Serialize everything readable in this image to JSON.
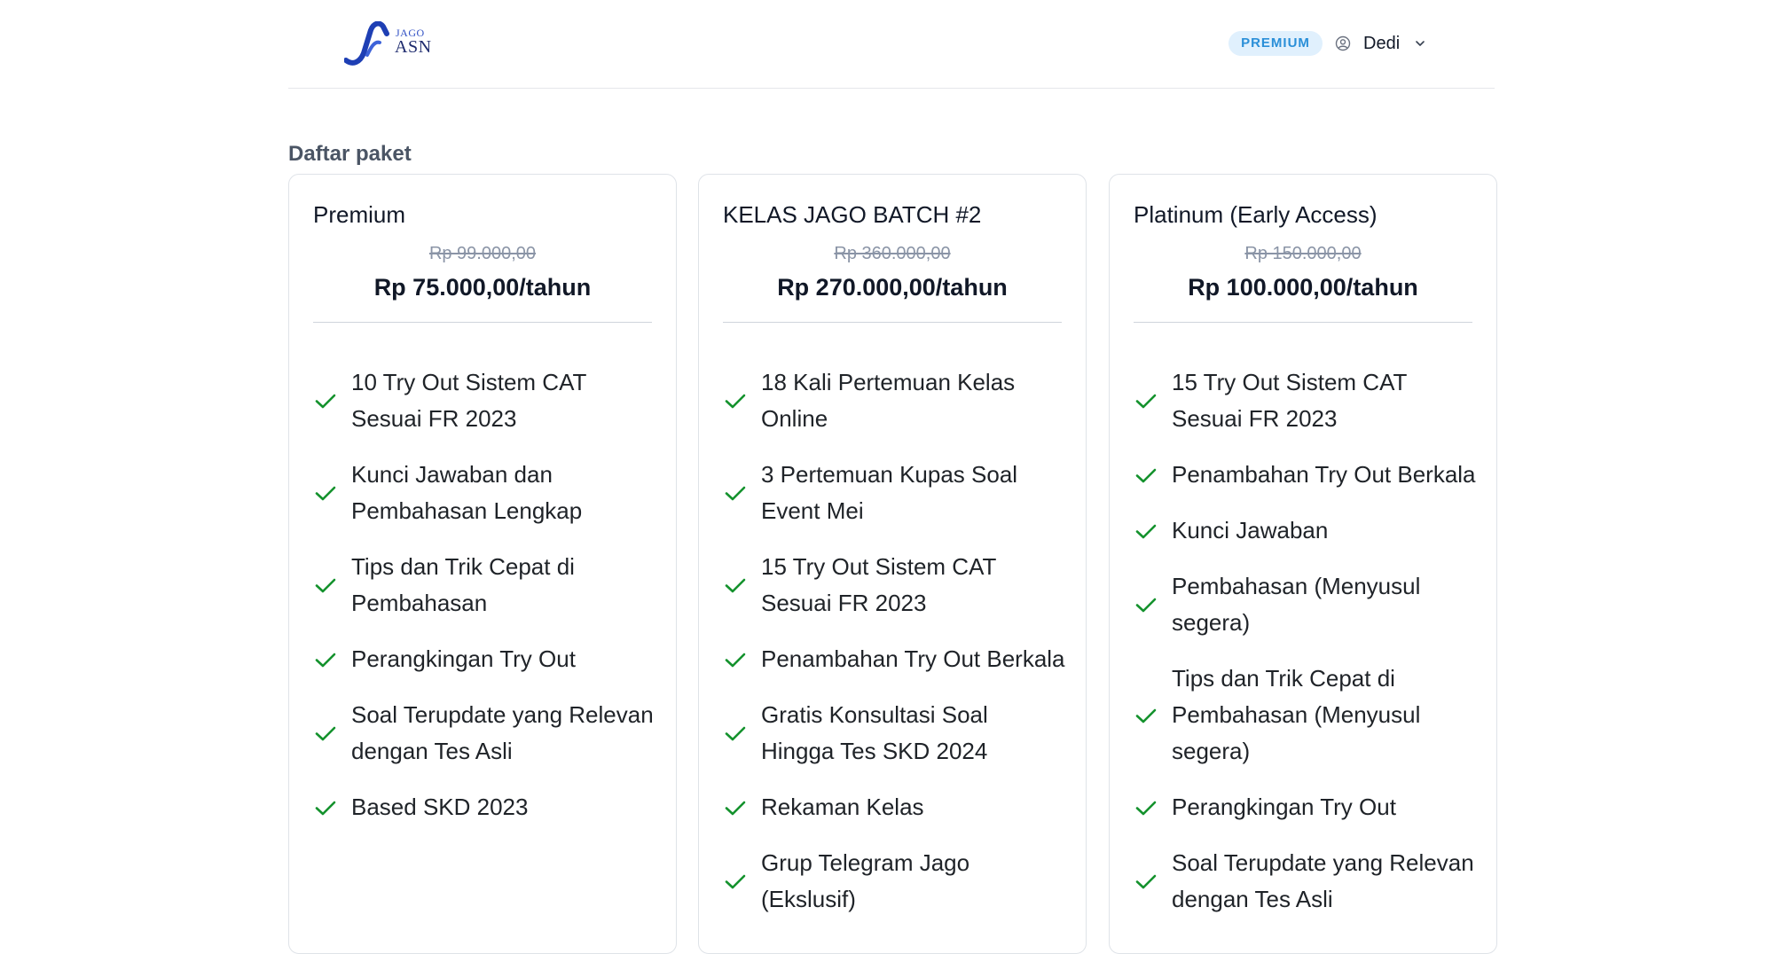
{
  "header": {
    "logo": {
      "top": "JAGO",
      "bottom": "ASN"
    },
    "badge": "PREMIUM",
    "user": {
      "name": "Dedi",
      "icon": "user-circle-icon",
      "menu_icon": "chevron-down-icon"
    }
  },
  "section_title": "Daftar paket",
  "colors": {
    "accent": "#2a8fd8",
    "badge_bg": "#e0f0fd",
    "check": "#14922d",
    "logo_blue": "#2f4fc4"
  },
  "packages": [
    {
      "name": "Premium",
      "old_price": "Rp 99.000,00",
      "price": "Rp 75.000,00/tahun",
      "features": [
        [
          "10 Try Out Sistem CAT",
          "Sesuai FR 2023"
        ],
        [
          "Kunci Jawaban dan",
          "Pembahasan Lengkap"
        ],
        [
          "Tips dan Trik Cepat di",
          "Pembahasan"
        ],
        [
          "Perangkingan Try Out"
        ],
        [
          "Soal Terupdate yang Relevan",
          "dengan Tes Asli"
        ],
        [
          "Based SKD 2023"
        ]
      ]
    },
    {
      "name": "KELAS JAGO BATCH #2",
      "old_price": "Rp 360.000,00",
      "price": "Rp 270.000,00/tahun",
      "features": [
        [
          "18 Kali Pertemuan Kelas",
          "Online"
        ],
        [
          "3 Pertemuan Kupas Soal",
          "Event Mei"
        ],
        [
          "15 Try Out Sistem CAT",
          "Sesuai FR 2023"
        ],
        [
          "Penambahan Try Out Berkala"
        ],
        [
          "Gratis Konsultasi Soal",
          "Hingga Tes SKD 2024"
        ],
        [
          "Rekaman Kelas"
        ],
        [
          "Grup Telegram Jago",
          "(Ekslusif)"
        ]
      ]
    },
    {
      "name": "Platinum (Early Access)",
      "old_price": "Rp 150.000,00",
      "price": "Rp 100.000,00/tahun",
      "features": [
        [
          "15 Try Out Sistem CAT",
          "Sesuai FR 2023"
        ],
        [
          "Penambahan Try Out Berkala"
        ],
        [
          "Kunci Jawaban"
        ],
        [
          "Pembahasan (Menyusul",
          "segera)"
        ],
        [
          "Tips dan Trik Cepat di",
          "Pembahasan (Menyusul",
          "segera)"
        ],
        [
          "Perangkingan Try Out"
        ],
        [
          "Soal Terupdate yang Relevan",
          "dengan Tes Asli"
        ]
      ]
    }
  ]
}
